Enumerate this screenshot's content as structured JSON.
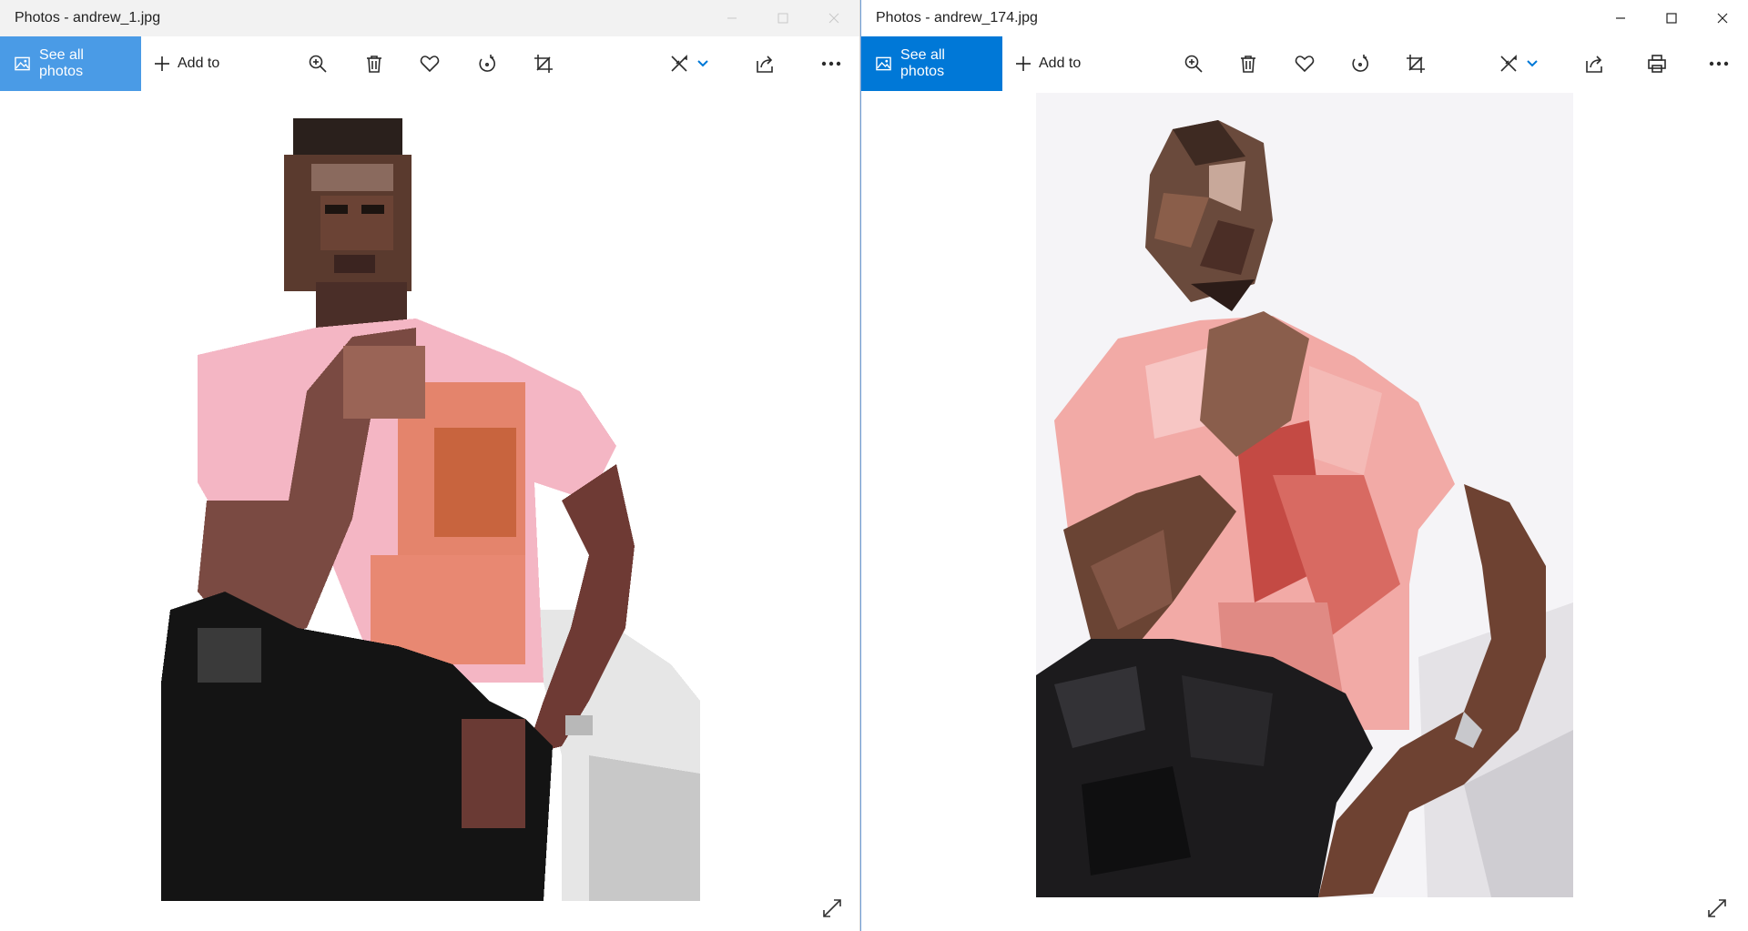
{
  "left_window": {
    "title": "Photos - andrew_1.jpg",
    "see_all_label": "See all photos",
    "add_to_label": "Add to",
    "photo_alt": "andrew_1.jpg"
  },
  "right_window": {
    "title": "Photos - andrew_174.jpg",
    "see_all_label": "See all photos",
    "add_to_label": "Add to",
    "photo_alt": "andrew_174.jpg"
  },
  "colors": {
    "accent_left": "#4a9be6",
    "accent_right": "#0078d7"
  }
}
